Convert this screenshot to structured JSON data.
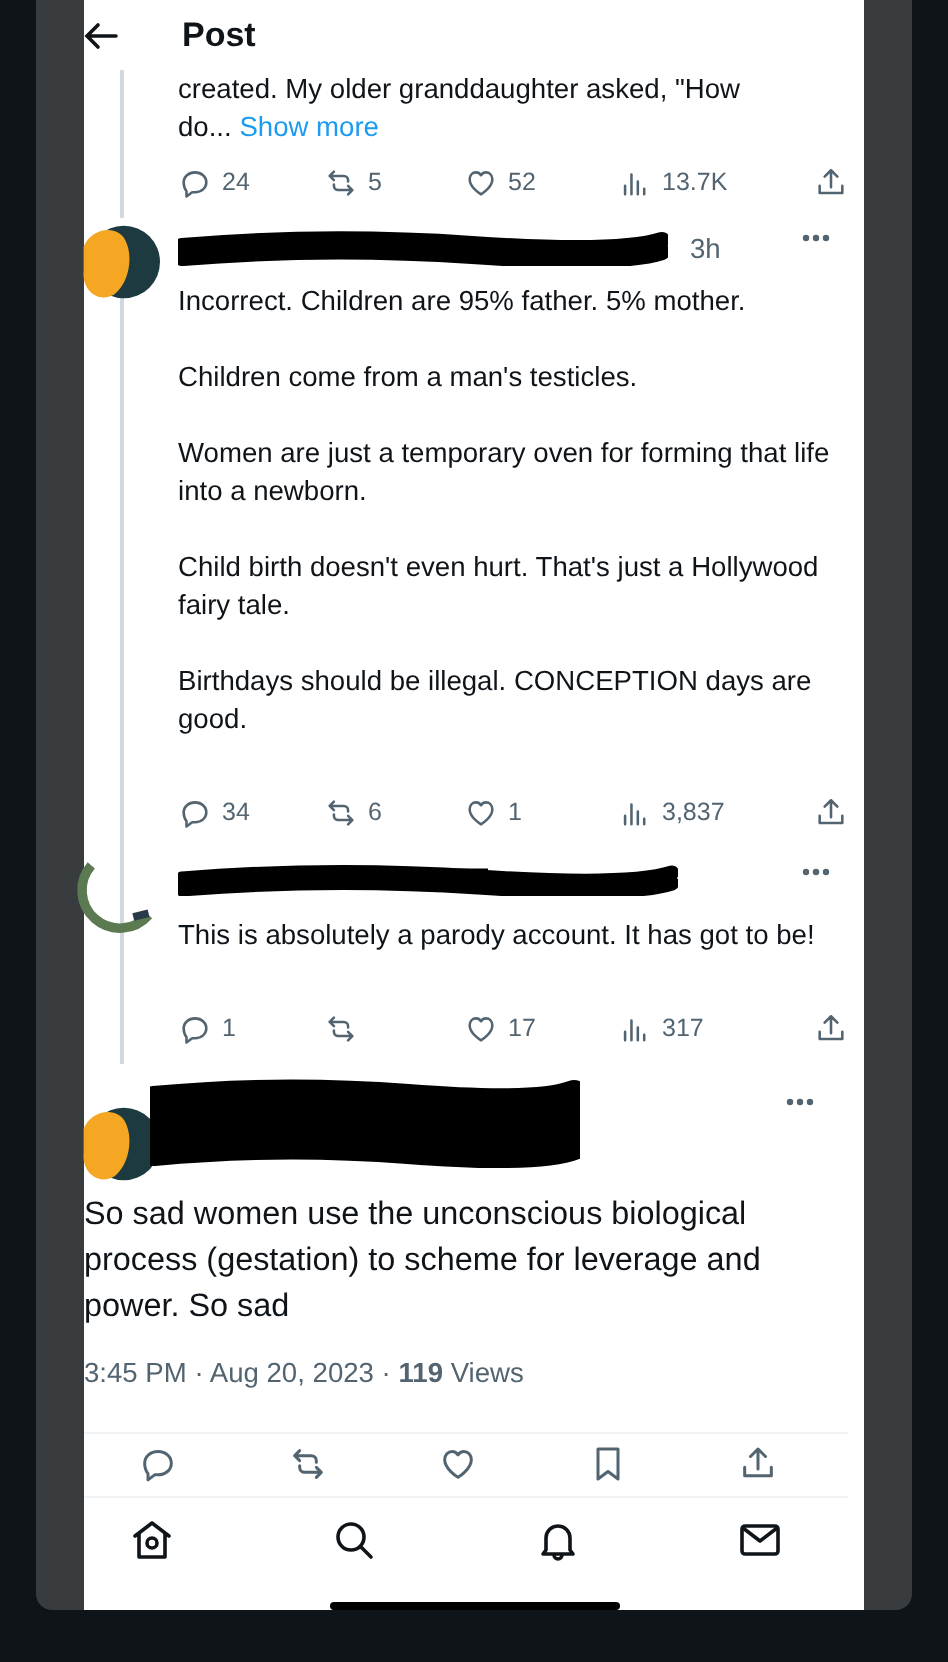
{
  "header": {
    "title": "Post"
  },
  "context_tweet": {
    "text": "created. My older granddaughter asked, \"How do...",
    "show_more": "Show more",
    "stats": {
      "replies": "24",
      "reposts": "5",
      "likes": "52",
      "views": "13.7K"
    }
  },
  "replies": [
    {
      "avatar": {
        "kind": "covered"
      },
      "time": "3h",
      "paragraphs": [
        "Incorrect. Children are 95% father. 5% mother.",
        "Children come from a man's testicles.",
        "Women are just a temporary oven for forming that life into a newborn.",
        "Child birth doesn't even hurt. That's just a Hollywood fairy tale.",
        "Birthdays should be illegal. CONCEPTION days are good."
      ],
      "stats": {
        "replies": "34",
        "reposts": "6",
        "likes": "1",
        "views": "3,837"
      }
    },
    {
      "avatar": {
        "kind": "photo"
      },
      "paragraphs": [
        "This is absolutely a parody account. It has got to be!"
      ],
      "stats": {
        "replies": "1",
        "likes": "17",
        "views": "317"
      }
    }
  ],
  "main_tweet": {
    "avatar": {
      "kind": "covered"
    },
    "text": "So sad women use the unconscious biological process (gestation) to scheme for leverage and power. So sad",
    "meta": "3:45 PM · Aug 20, 2023 · **119** Views"
  },
  "actions": [
    {
      "kind": "reply"
    },
    {
      "kind": "repost"
    },
    {
      "kind": "like"
    },
    {
      "kind": "bookmark"
    },
    {
      "kind": "share"
    }
  ],
  "nav": [
    {
      "kind": "home"
    },
    {
      "kind": "search"
    },
    {
      "kind": "bell"
    },
    {
      "kind": "mail"
    }
  ]
}
